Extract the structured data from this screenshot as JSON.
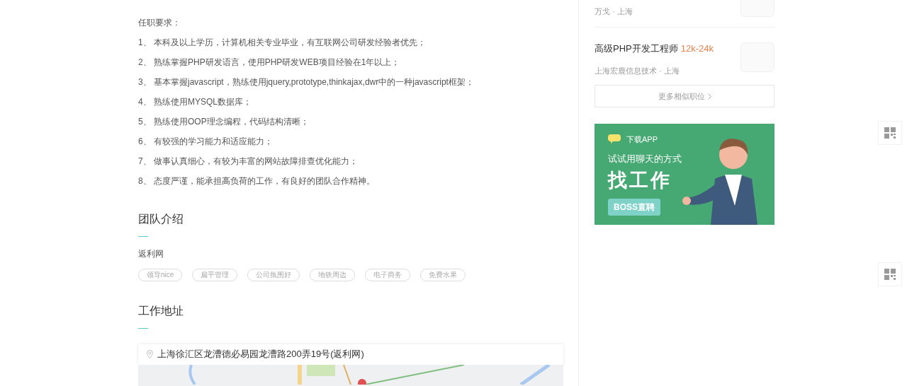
{
  "requirements": {
    "title": "任职要求：",
    "items": [
      "1、 本科及以上学历，计算机相关专业毕业，有互联网公司研发经验者优先；",
      "2、 熟练掌握PHP研发语言，使用PHP研发WEB项目经验在1年以上；",
      "3、 基本掌握javascript，熟练使用jquery,prototype,thinkajax,dwr中的一种javascript框架；",
      "4、 熟练使用MYSQL数据库；",
      "5、 熟练使用OOP理念编程，代码结构清晰；",
      "6、 有较强的学习能力和适应能力；",
      "7、 做事认真细心，有较为丰富的网站故障排查优化能力；",
      "8、 态度严谨，能承担高负荷的工作，有良好的团队合作精神。"
    ]
  },
  "team": {
    "title": "团队介绍",
    "name": "返利网",
    "tags": [
      "领导nice",
      "扁平管理",
      "公司氛围好",
      "地铁周边",
      "电子商务",
      "免费水果"
    ]
  },
  "address": {
    "title": "工作地址",
    "text": "上海徐汇区龙漕德必易园龙漕路200弄19号(返利网)"
  },
  "similar_jobs": [
    {
      "meta": "万戈 · 上海"
    },
    {
      "title": "高级PHP开发工程师",
      "salary": "12k-24k",
      "meta": "上海宏鹿信息技术 · 上海"
    }
  ],
  "more_button": "更多相似职位",
  "banner": {
    "tag": "下载APP",
    "line": "试试用聊天的方式",
    "headline": "找工作",
    "brand": "BOSS直聘"
  }
}
